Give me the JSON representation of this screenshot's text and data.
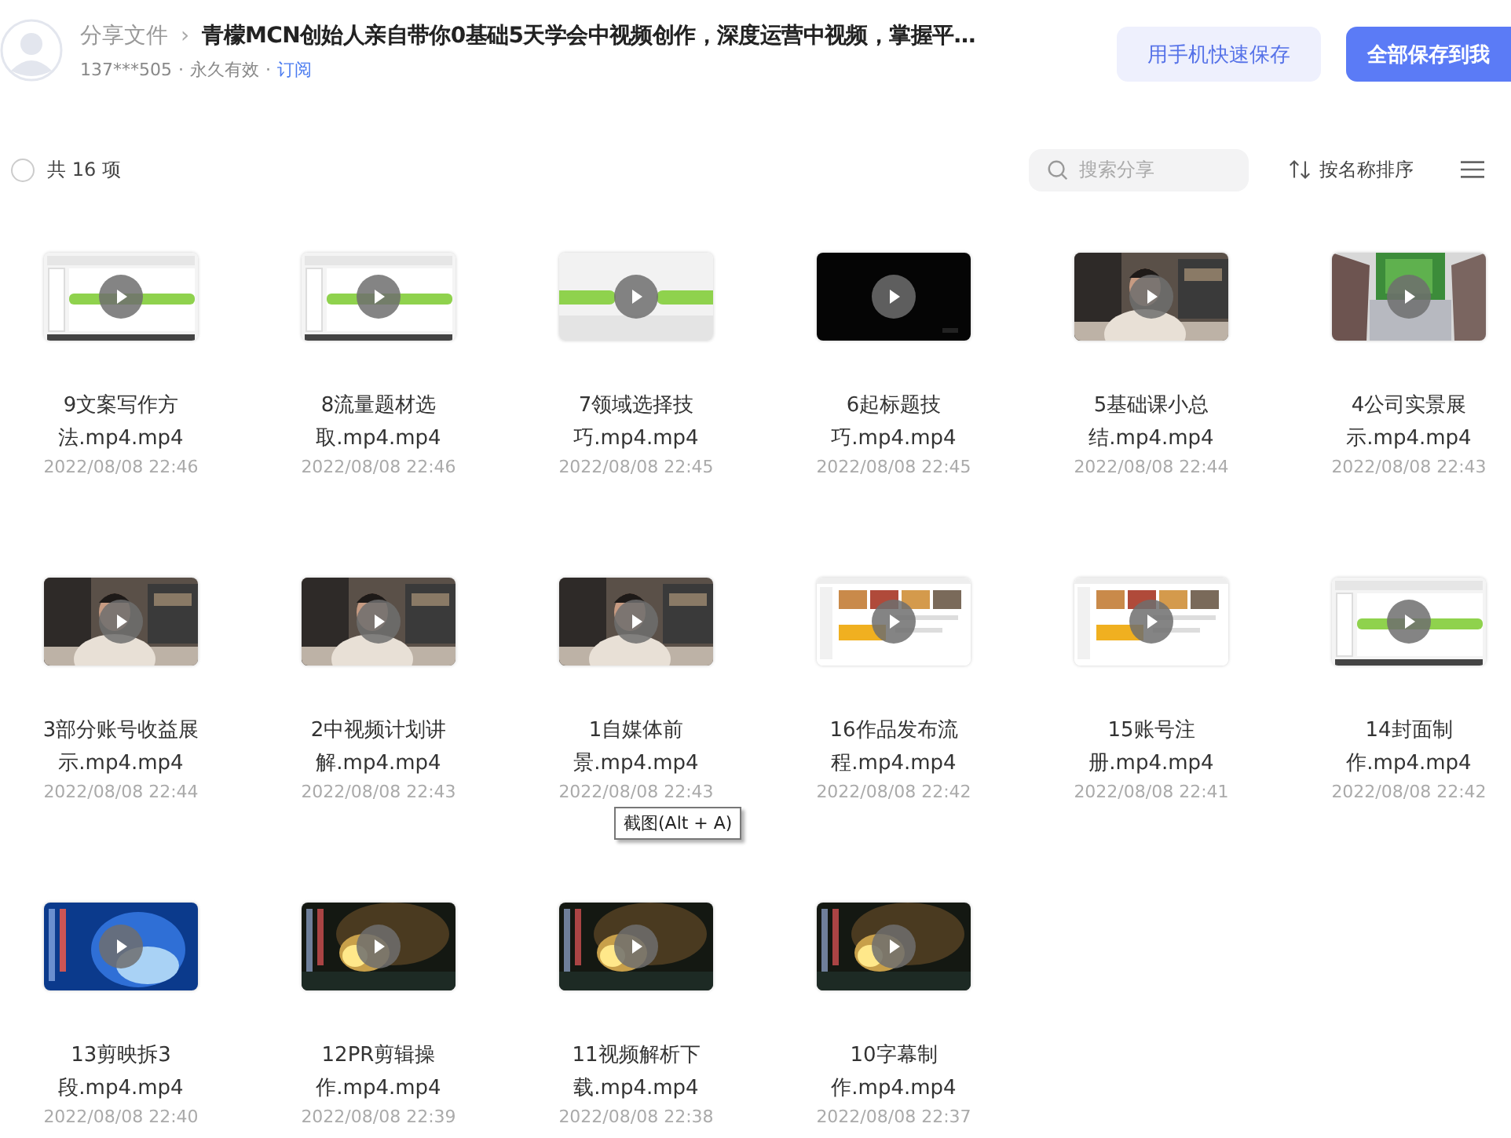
{
  "header": {
    "breadcrumb": "分享文件",
    "separator": "›",
    "title": "青檬MCN创始人亲自带你0基础5天学会中视频创作，深度运营中视频，掌握平…",
    "owner": "137***505",
    "dot_1": "·",
    "validity": "永久有效",
    "dot_2": "·",
    "subscribe": "订阅",
    "buttons": [
      {
        "label": "用手机快速保存",
        "kind": "secondary"
      },
      {
        "label": "全部保存到我",
        "kind": "primary"
      }
    ]
  },
  "toolbar": {
    "select_all": {
      "checked": false
    },
    "count": "共 16 项",
    "search": {
      "placeholder": "搜索分享"
    },
    "sort": "按名称排序"
  },
  "files": [
    {
      "name": "9文案写作方法.mp4.mp4",
      "date": "2022/08/08 22:46",
      "kind": "picture"
    },
    {
      "name": "8流量题材选取.mp4.mp4",
      "date": "2022/08/08 22:46",
      "kind": "picture"
    },
    {
      "name": "7领域选择技巧.mp4.mp4",
      "date": "2022/08/08 22:45",
      "kind": "picture"
    },
    {
      "name": "6起标题技巧.mp4.mp4",
      "date": "2022/08/08 22:45",
      "kind": "picture"
    },
    {
      "name": "5基础课小总结.mp4.mp4",
      "date": "2022/08/08 22:44",
      "kind": "picture"
    },
    {
      "name": "4公司实景展示.mp4.mp4",
      "date": "2022/08/08 22:43",
      "kind": "picture"
    },
    {
      "name": "3部分账号收益展示.mp4.mp4",
      "date": "2022/08/08 22:44",
      "kind": "picture"
    },
    {
      "name": "2中视频计划讲解.mp4.mp4",
      "date": "2022/08/08 22:43",
      "kind": "picture"
    },
    {
      "name": "1自媒体前景.mp4.mp4",
      "date": "2022/08/08 22:43",
      "kind": "picture"
    },
    {
      "name": "16作品发布流程.mp4.mp4",
      "date": "2022/08/08 22:42",
      "kind": "picture"
    },
    {
      "name": "15账号注册.mp4.mp4",
      "date": "2022/08/08 22:41",
      "kind": "picture"
    },
    {
      "name": "14封面制作.mp4.mp4",
      "date": "2022/08/08 22:42",
      "kind": "picture"
    },
    {
      "name": "13剪映拆3段.mp4.mp4",
      "date": "2022/08/08 22:40",
      "kind": "picture"
    },
    {
      "name": "12PR剪辑操作.mp4.mp4",
      "date": "2022/08/08 22:39",
      "kind": "picture"
    },
    {
      "name": "11视频解析下载.mp4.mp4",
      "date": "2022/08/08 22:38",
      "kind": "picture"
    },
    {
      "name": "10字幕制作.mp4.mp4",
      "date": "2022/08/08 22:37",
      "kind": "picture"
    }
  ],
  "tooltip": "截图(Alt + A)"
}
